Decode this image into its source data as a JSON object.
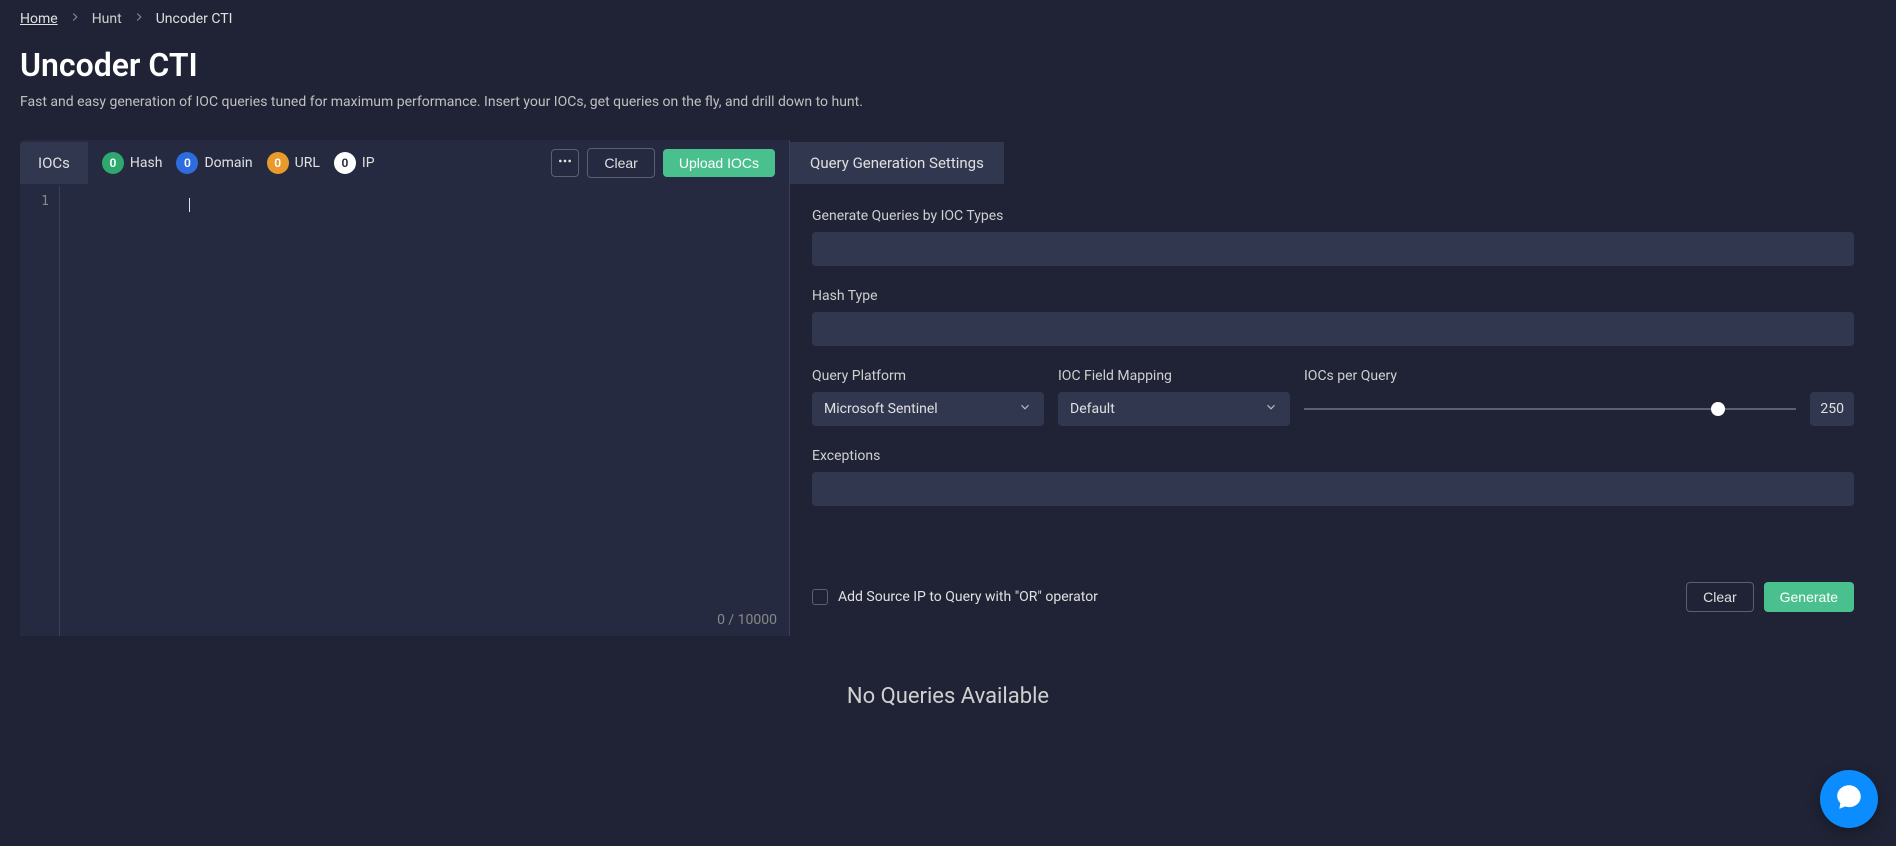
{
  "breadcrumb": {
    "home": "Home",
    "hunt": "Hunt",
    "current": "Uncoder CTI"
  },
  "header": {
    "title": "Uncoder CTI",
    "subtitle": "Fast and easy generation of IOC queries tuned for maximum performance. Insert your IOCs, get queries on the fly, and drill down to hunt."
  },
  "left": {
    "tab_label": "IOCs",
    "badges": {
      "hash": {
        "count": "0",
        "label": "Hash"
      },
      "domain": {
        "count": "0",
        "label": "Domain"
      },
      "url": {
        "count": "0",
        "label": "URL"
      },
      "ip": {
        "count": "0",
        "label": "IP"
      }
    },
    "clear_label": "Clear",
    "upload_label": "Upload IOCs",
    "line_number": "1",
    "counter": "0 / 10000"
  },
  "right": {
    "tab_label": "Query Generation Settings",
    "labels": {
      "ioc_types": "Generate Queries by IOC Types",
      "hash_type": "Hash Type",
      "platform": "Query Platform",
      "mapping": "IOC Field Mapping",
      "iocs_per_query": "IOCs per Query",
      "exceptions": "Exceptions",
      "checkbox": "Add Source IP to Query with \"OR\" operator"
    },
    "platform_value": "Microsoft Sentinel",
    "mapping_value": "Default",
    "slider_value": "250",
    "clear_label": "Clear",
    "generate_label": "Generate"
  },
  "no_queries": "No Queries Available"
}
